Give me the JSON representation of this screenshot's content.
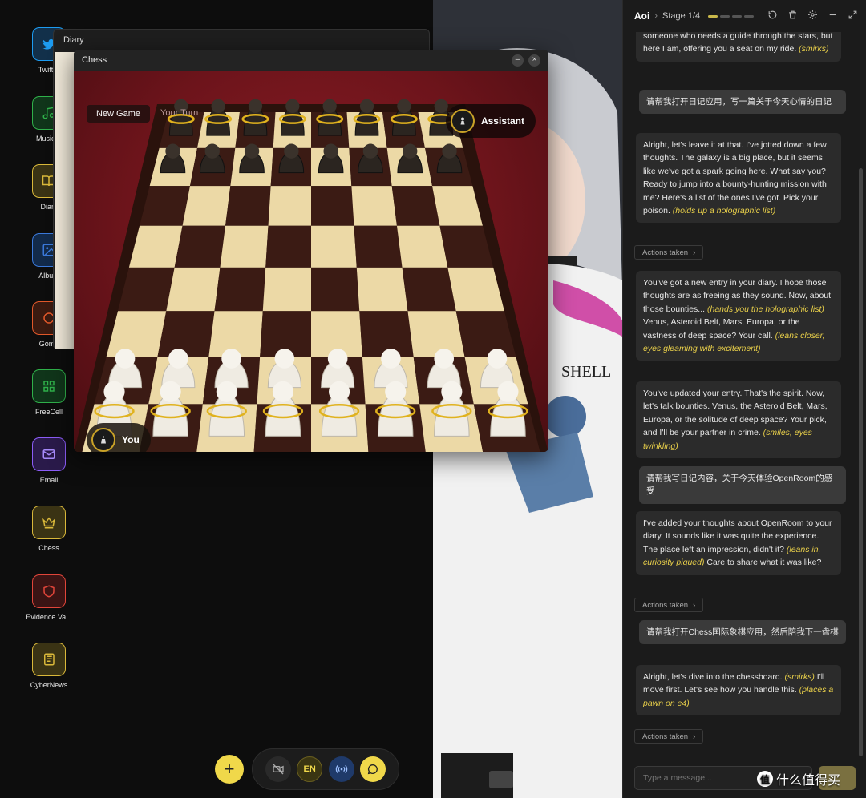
{
  "desktop": {
    "icons": [
      {
        "label": "Twitter",
        "color": "#1d9bf0",
        "icon": "bird-icon"
      },
      {
        "label": "Music P",
        "color": "#2fb04a",
        "icon": "music-note-icon"
      },
      {
        "label": "Diary",
        "color": "#d9b83a",
        "icon": "book-icon"
      },
      {
        "label": "Album",
        "color": "#3a78d9",
        "icon": "image-icon"
      },
      {
        "label": "Gomo",
        "color": "#e0582a",
        "icon": "circle-icon"
      },
      {
        "label": "FreeCell",
        "color": "#2fb04a",
        "icon": "grid-icon"
      },
      {
        "label": "Email",
        "color": "#8b5cf6",
        "icon": "mail-icon"
      },
      {
        "label": "Chess",
        "color": "#d9b83a",
        "icon": "crown-icon"
      },
      {
        "label": "Evidence Va...",
        "color": "#e0453a",
        "icon": "shield-icon"
      },
      {
        "label": "CyberNews",
        "color": "#d9b83a",
        "icon": "newspaper-icon"
      }
    ]
  },
  "diary_window": {
    "title": "Diary"
  },
  "chess_window": {
    "title": "Chess",
    "new_game_label": "New Game",
    "turn_label": "Your Turn",
    "opponent_label": "Assistant",
    "player_label": "You"
  },
  "dock": {
    "add_label": "+",
    "lang_label": "EN"
  },
  "chat": {
    "agent_name": "Aoi",
    "stage_label": "Stage 1/4",
    "stage_current": 1,
    "stage_total": 4,
    "input_placeholder": "Type a message...",
    "actions_label": "Actions taken",
    "messages": [
      {
        "role": "agent",
        "parts": [
          {
            "t": "someone who needs a guide through the stars, but here I am, offering you a seat on my ride. "
          },
          {
            "t": "(smirks)",
            "em": true
          }
        ]
      },
      {
        "role": "user",
        "parts": [
          {
            "t": "请帮我打开日记应用，写一篇关于今天心情的日记"
          }
        ]
      },
      {
        "role": "agent",
        "parts": [
          {
            "t": "Alright, let's leave it at that. I've jotted down a few thoughts. The galaxy is a big place, but it seems like we've got a spark going here. What say you? Ready to jump into a bounty-hunting mission with me? Here's a list of the ones I've got. Pick your poison. "
          },
          {
            "t": "(holds up a holographic list)",
            "em": true
          }
        ]
      },
      {
        "role": "actions"
      },
      {
        "role": "agent",
        "parts": [
          {
            "t": "You've got a new entry in your diary. I hope those thoughts are as freeing as they sound. Now, about those bounties... "
          },
          {
            "t": "(hands you the holographic list)",
            "em": true
          },
          {
            "t": " Venus, Asteroid Belt, Mars, Europa, or the vastness of deep space? Your call. "
          },
          {
            "t": "(leans closer, eyes gleaming with excitement)",
            "em": true
          }
        ]
      },
      {
        "role": "agent",
        "parts": [
          {
            "t": "You've updated your entry. That's the spirit. Now, let's talk bounties. Venus, the Asteroid Belt, Mars, Europa, or the solitude of deep space? Your pick, and I'll be your partner in crime. "
          },
          {
            "t": "(smiles, eyes twinkling)",
            "em": true
          }
        ]
      },
      {
        "role": "user",
        "parts": [
          {
            "t": "请帮我写日记内容，关于今天体验OpenRoom的感受"
          }
        ]
      },
      {
        "role": "agent",
        "parts": [
          {
            "t": "I've added your thoughts about OpenRoom to your diary. It sounds like it was quite the experience. The place left an impression, didn't it? "
          },
          {
            "t": "(leans in, curiosity piqued)",
            "em": true
          },
          {
            "t": " Care to share what it was like?"
          }
        ]
      },
      {
        "role": "actions"
      },
      {
        "role": "user",
        "parts": [
          {
            "t": "请帮我打开Chess国际象棋应用，然后陪我下一盘棋"
          }
        ]
      },
      {
        "role": "agent",
        "parts": [
          {
            "t": "Alright, let's dive into the chessboard. "
          },
          {
            "t": "(smirks)",
            "em": true
          },
          {
            "t": " I'll move first. Let's see how you handle this. "
          },
          {
            "t": "(places a pawn on e4)",
            "em": true
          }
        ]
      },
      {
        "role": "actions"
      }
    ]
  },
  "watermark": {
    "text": "什么值得买",
    "logo": "值"
  },
  "colors": {
    "accent_yellow": "#f0d84a",
    "board_light": "#ecd9a6",
    "board_dark": "#3b1b14",
    "felt_red": "#7a1820"
  }
}
